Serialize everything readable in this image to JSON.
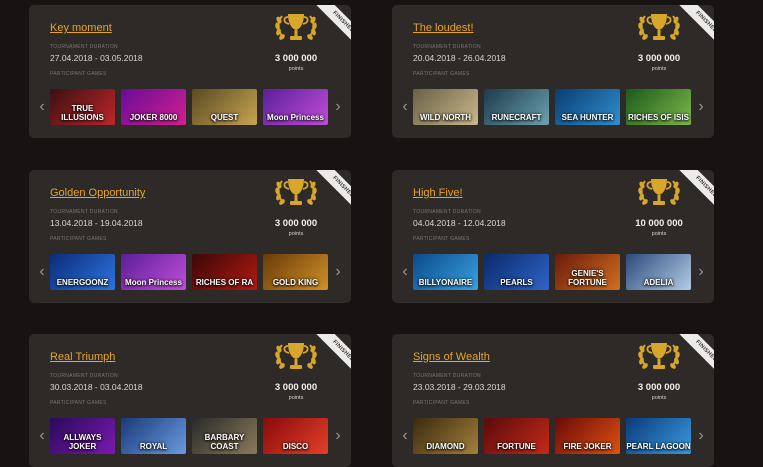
{
  "tournaments": [
    {
      "title": "Key moment",
      "duration_label": "TOURNAMENT DURATION",
      "duration": "27.04.2018 - 03.05.2018",
      "points": "3 000 000",
      "points_label": "points",
      "status": "FINISHED",
      "games_label": "PARTICIPANT GAMES",
      "games": [
        {
          "name": "TRUE ILLUSIONS",
          "colors": [
            "#3a1010",
            "#c0262a"
          ]
        },
        {
          "name": "JOKER 8000",
          "colors": [
            "#6a0a9a",
            "#d1218c"
          ]
        },
        {
          "name": "QUEST",
          "colors": [
            "#5a4a22",
            "#c7a452"
          ]
        },
        {
          "name": "Moon Princess",
          "colors": [
            "#5b1f9a",
            "#c14ed8"
          ]
        }
      ]
    },
    {
      "title": "The loudest!",
      "duration_label": "TOURNAMENT DURATION",
      "duration": "20.04.2018 - 26.04.2018",
      "points": "3 000 000",
      "points_label": "points",
      "status": "FINISHED",
      "games_label": "PARTICIPANT GAMES",
      "games": [
        {
          "name": "WILD NORTH",
          "colors": [
            "#6a6048",
            "#c9b98a"
          ]
        },
        {
          "name": "RUNECRAFT",
          "colors": [
            "#1c3a4a",
            "#6da2b2"
          ]
        },
        {
          "name": "SEA HUNTER",
          "colors": [
            "#0b3d72",
            "#2e8fd0"
          ]
        },
        {
          "name": "RICHES OF ISIS",
          "colors": [
            "#1a5a1a",
            "#7fb84a"
          ]
        }
      ]
    },
    {
      "title": "Golden Opportunity",
      "duration_label": "TOURNAMENT DURATION",
      "duration": "13.04.2018 - 19.04.2018",
      "points": "3 000 000",
      "points_label": "points",
      "status": "FINISHED",
      "games_label": "PARTICIPANT GAMES",
      "games": [
        {
          "name": "ENERGOONZ",
          "colors": [
            "#0a2c78",
            "#2e74e0"
          ]
        },
        {
          "name": "Moon Princess",
          "colors": [
            "#5b1f9a",
            "#c14ed8"
          ]
        },
        {
          "name": "RICHES OF RA",
          "colors": [
            "#3a0808",
            "#b11a12"
          ]
        },
        {
          "name": "GOLD KING",
          "colors": [
            "#6a3a0a",
            "#d09028"
          ]
        }
      ]
    },
    {
      "title": "High Five!",
      "duration_label": "TOURNAMENT DURATION",
      "duration": "04.04.2018 - 12.04.2018",
      "points": "10 000 000",
      "points_label": "points",
      "status": "FINISHED",
      "games_label": "PARTICIPANT GAMES",
      "games": [
        {
          "name": "BILLYONAIRE",
          "colors": [
            "#0b4a8a",
            "#3aa0e0"
          ]
        },
        {
          "name": "PEARLS",
          "colors": [
            "#0a2a6a",
            "#3064c8"
          ]
        },
        {
          "name": "GENIE'S FORTUNE",
          "colors": [
            "#6a1a0a",
            "#d07020"
          ]
        },
        {
          "name": "ADELIA",
          "colors": [
            "#2a4a7a",
            "#b4cce6"
          ]
        }
      ]
    },
    {
      "title": "Real Triumph",
      "duration_label": "TOURNAMENT DURATION",
      "duration": "30.03.2018 - 03.04.2018",
      "points": "3 000 000",
      "points_label": "points",
      "status": "FINISHED",
      "games_label": "PARTICIPANT GAMES",
      "games": [
        {
          "name": "ALLWAYS JOKER",
          "colors": [
            "#2a0a5a",
            "#7a1ab0"
          ]
        },
        {
          "name": "ROYAL",
          "colors": [
            "#1a3a7a",
            "#6a9ae0"
          ]
        },
        {
          "name": "BARBARY COAST",
          "colors": [
            "#2a2a2a",
            "#8a7a5a"
          ]
        },
        {
          "name": "DISCO",
          "colors": [
            "#8a0a0a",
            "#e2402a"
          ]
        }
      ]
    },
    {
      "title": "Signs of Wealth",
      "duration_label": "TOURNAMENT DURATION",
      "duration": "23.03.2018 - 29.03.2018",
      "points": "3 000 000",
      "points_label": "points",
      "status": "FINISHED",
      "games_label": "PARTICIPANT GAMES",
      "games": [
        {
          "name": "DIAMOND",
          "colors": [
            "#3a2a10",
            "#a4803a"
          ]
        },
        {
          "name": "FORTUNE",
          "colors": [
            "#5a0a0a",
            "#c42a1a"
          ]
        },
        {
          "name": "FIRE JOKER",
          "colors": [
            "#6a0a0a",
            "#e05010"
          ]
        },
        {
          "name": "PEARL LAGOON",
          "colors": [
            "#0a3a7a",
            "#3a9ae0"
          ]
        }
      ]
    }
  ],
  "theme": {
    "accent": "#e7a42a",
    "card_bg": "#2d2a28",
    "page_bg": "#161312",
    "trophy_gold": "#d8a62a"
  },
  "icons": {
    "trophy": "trophy-icon",
    "prev": "chevron-left-icon",
    "next": "chevron-right-icon"
  }
}
